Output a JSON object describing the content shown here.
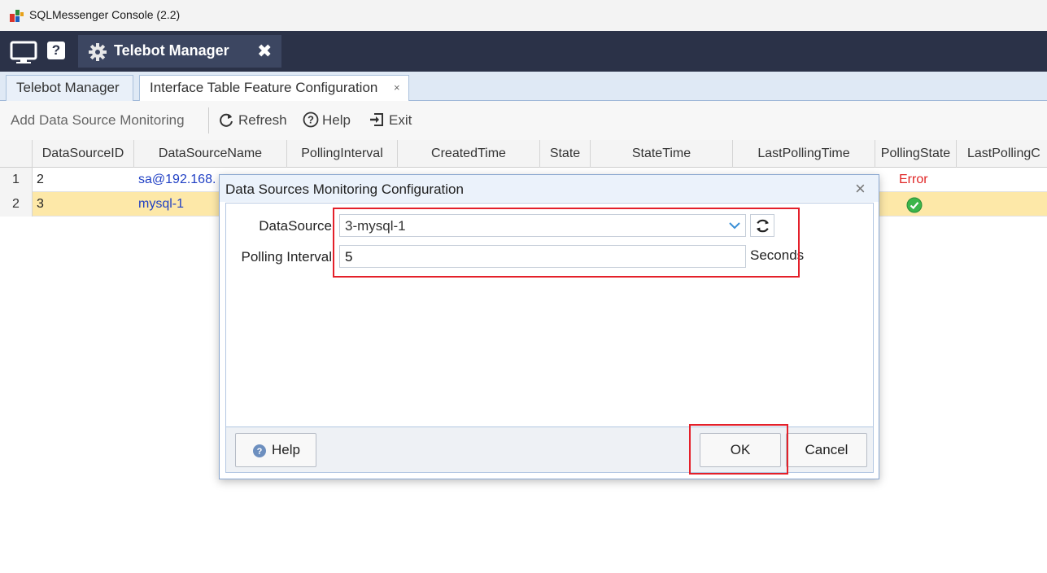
{
  "window": {
    "title": "SQLMessenger Console (2.2)",
    "icon": "app-logo-icon"
  },
  "topnav": {
    "monitor_icon": "monitor-icon",
    "help_label": "?",
    "active_tab": {
      "label": "Telebot Manager",
      "icon": "gear-icon",
      "close_label": "✖"
    }
  },
  "doc_tabs": [
    {
      "label": "Telebot Manager"
    },
    {
      "label": "Interface Table Feature Configuration",
      "close_label": "×"
    }
  ],
  "toolbar": {
    "add_label": "Add Data Source Monitoring",
    "refresh_label": "Refresh",
    "help_label": "Help",
    "exit_label": "Exit"
  },
  "grid": {
    "columns": [
      "DataSourceID",
      "DataSourceName",
      "PollingInterval",
      "CreatedTime",
      "State",
      "StateTime",
      "LastPollingTime",
      "PollingState",
      "LastPollingC"
    ],
    "rows": [
      {
        "num": "1",
        "id": "2",
        "name": "sa@192.168.",
        "polling_state": "Error"
      },
      {
        "num": "2",
        "id": "3",
        "name": "mysql-1",
        "polling_state": "ok"
      }
    ]
  },
  "dialog": {
    "title": "Data Sources Monitoring Configuration",
    "close_label": "×",
    "datasource_label": "DataSource",
    "datasource_value": "3-mysql-1",
    "polling_label": "Polling Interval",
    "polling_value": "5",
    "polling_unit": "Seconds",
    "help_button": "Help",
    "ok_button": "OK",
    "cancel_button": "Cancel"
  },
  "colors": {
    "nav_bg": "#2b3248",
    "highlight": "#e4202a",
    "selected_row": "#fde8a8",
    "link": "#1f3fc4",
    "error": "#e02525"
  }
}
